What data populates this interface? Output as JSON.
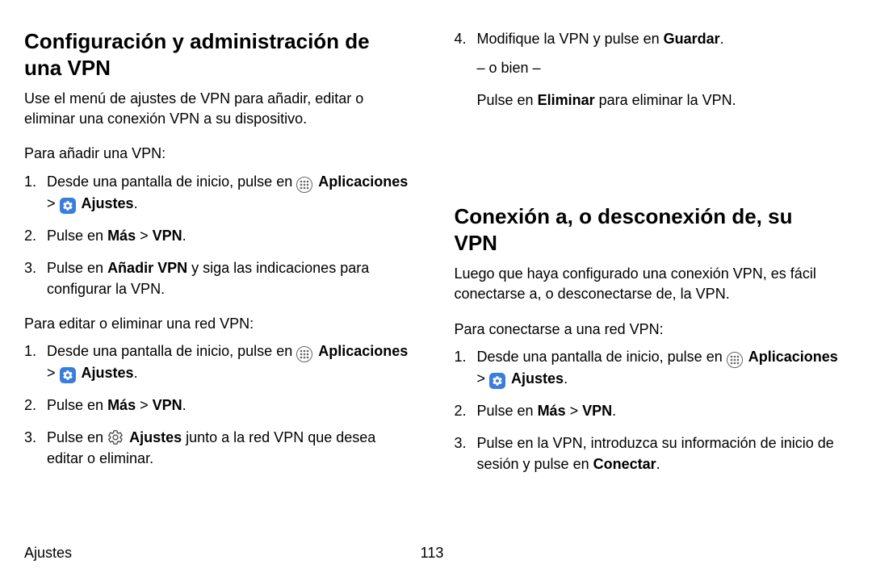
{
  "left": {
    "heading": "Configuración y administración de una VPN",
    "intro": "Use el menú de ajustes de VPN para añadir, editar o eliminar una conexión VPN a su dispositivo.",
    "addIntro": "Para añadir una VPN:",
    "add": {
      "s1a": "Desde una pantalla de inicio, pulse en ",
      "apps": "Aplicaciones",
      "sep": " > ",
      "settings": "Ajustes",
      "dot": ".",
      "s2a": "Pulse en ",
      "mas": "Más",
      "vpn": "VPN",
      "s3a": "Pulse en ",
      "addvpn": "Añadir VPN",
      "s3b": " y siga las indicaciones para configurar la VPN."
    },
    "editIntro": "Para editar o eliminar una red VPN:",
    "edit": {
      "s3a": "Pulse en ",
      "ajustes2": "Ajustes",
      "s3b": " junto a la red VPN que desea editar o eliminar."
    }
  },
  "rightTop": {
    "s4a": "Modifique la VPN y pulse en ",
    "guardar": "Guardar",
    "dot": ".",
    "obien": "– o bien –",
    "pulse": "Pulse en ",
    "eliminar": "Eliminar",
    "rest": " para eliminar la VPN."
  },
  "right": {
    "heading": "Conexión a, o desconexión de, su VPN",
    "intro": "Luego que haya configurado una conexión VPN, es fácil conectarse a, o desconectarse de, la VPN.",
    "connectIntro": "Para conectarse a una red VPN:",
    "s3a": "Pulse en la VPN, introduzca su información de inicio de sesión y pulse en ",
    "conectar": "Conectar",
    "dot": "."
  },
  "footer": {
    "section": "Ajustes",
    "page": "113"
  }
}
